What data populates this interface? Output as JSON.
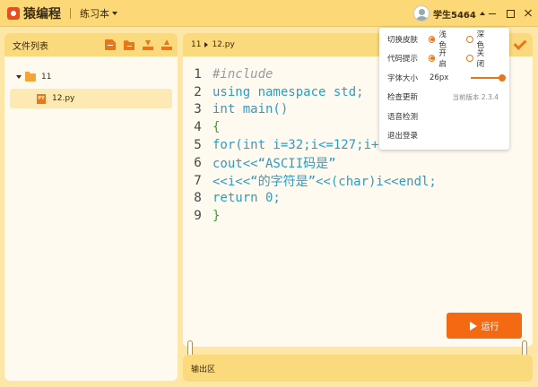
{
  "topbar": {
    "app_name": "猿编程",
    "practice_menu": "练习本",
    "username": "学生5464"
  },
  "sidebar": {
    "title": "文件列表",
    "tree": {
      "folder_name": "11",
      "file_name": "12.py",
      "file_icon_text": "PY"
    }
  },
  "editor": {
    "breadcrumb_folder": "11",
    "breadcrumb_file": "12.py",
    "lines": [
      {
        "no": "1",
        "text": "#include"
      },
      {
        "no": "2",
        "text": "using namespace std;"
      },
      {
        "no": "3",
        "text": "int main()"
      },
      {
        "no": "4",
        "text": "{"
      },
      {
        "no": "5",
        "text": "for(int i=32;i<=127;i+."
      },
      {
        "no": "6",
        "text": "cout<<“ASCII码是”"
      },
      {
        "no": "7",
        "text": "<<i<<“的字符是”<<(char)i<<endl;"
      },
      {
        "no": "8",
        "text": "return 0;"
      },
      {
        "no": "9",
        "text": "}"
      }
    ],
    "run_label": "运行"
  },
  "output": {
    "title": "输出区"
  },
  "settings": {
    "theme": {
      "label": "切换皮肤",
      "opt1": "浅色",
      "opt2": "深色",
      "selected": "浅色"
    },
    "hint": {
      "label": "代码提示",
      "opt1": "开启",
      "opt2": "关闭",
      "selected": "开启"
    },
    "font": {
      "label": "字体大小",
      "value": "26px",
      "level": 0.88
    },
    "update": {
      "label": "检查更新",
      "version": "当前版本 2.3.4"
    },
    "voice": {
      "label": "语音检测"
    },
    "logout": {
      "label": "退出登录"
    }
  },
  "colors": {
    "accent": "#e8761b",
    "run_button": "#f36a12",
    "header": "#fbd97d",
    "code_keyword": "#2e9bc7",
    "code_brace": "#2aa52a"
  }
}
